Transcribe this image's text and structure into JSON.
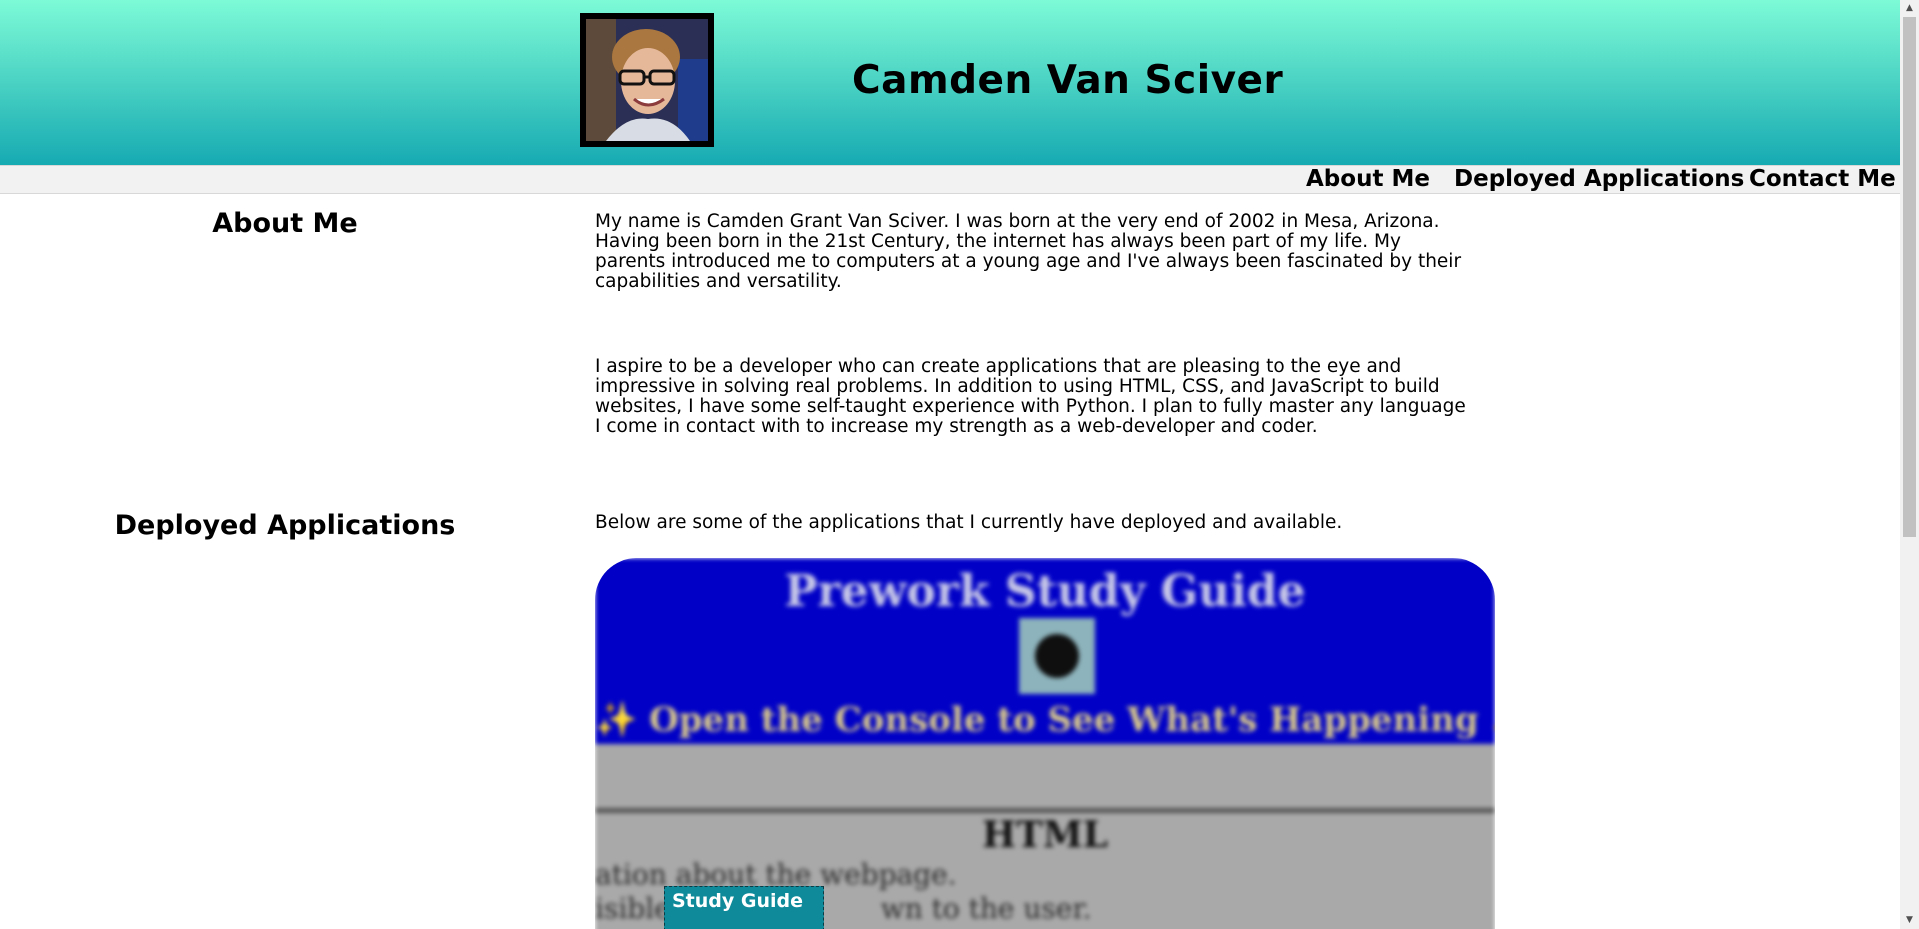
{
  "header": {
    "title": "Camden Van Sciver",
    "avatar_alt": "Photo of Camden Van Sciver"
  },
  "nav": {
    "items": [
      {
        "label": "About Me"
      },
      {
        "label": "Deployed Applications"
      },
      {
        "label": "Contact Me"
      }
    ]
  },
  "about": {
    "heading": "About Me",
    "paragraphs": [
      "My name is Camden Grant Van Sciver. I was born at the very end of 2002 in Mesa, Arizona. Having been born in the 21st Century, the internet has always been part of my life. My parents introduced me to computers at a young age and I've always been fascinated by their capabilities and versatility.",
      "I aspire to be a developer who can create applications that are pleasing to the eye and impressive in solving real problems. In addition to using HTML, CSS, and JavaScript to build websites, I have some self-taught experience with Python. I plan to fully master any language I come in contact with to increase my strength as a web-developer and coder."
    ]
  },
  "deployed": {
    "heading": "Deployed Applications",
    "intro": "Below are some of the applications that I currently have deployed and available.",
    "projects": [
      {
        "label": "Study Guide",
        "preview": {
          "title": "Prework Study Guide",
          "subtitle": "✨ Open the Console to See What's Happening ✨",
          "section_title": "HTML",
          "line_1": "ation about the webpage.",
          "line_2": "isible",
          "line_2_end": "wn to the user."
        }
      }
    ]
  },
  "colors": {
    "header_top": "#7dfbd7",
    "header_bottom": "#16aab2",
    "nav_background": "#f2f2f2",
    "project_label_background": "#0e8a9a",
    "preview_blue": "#0000c7"
  }
}
